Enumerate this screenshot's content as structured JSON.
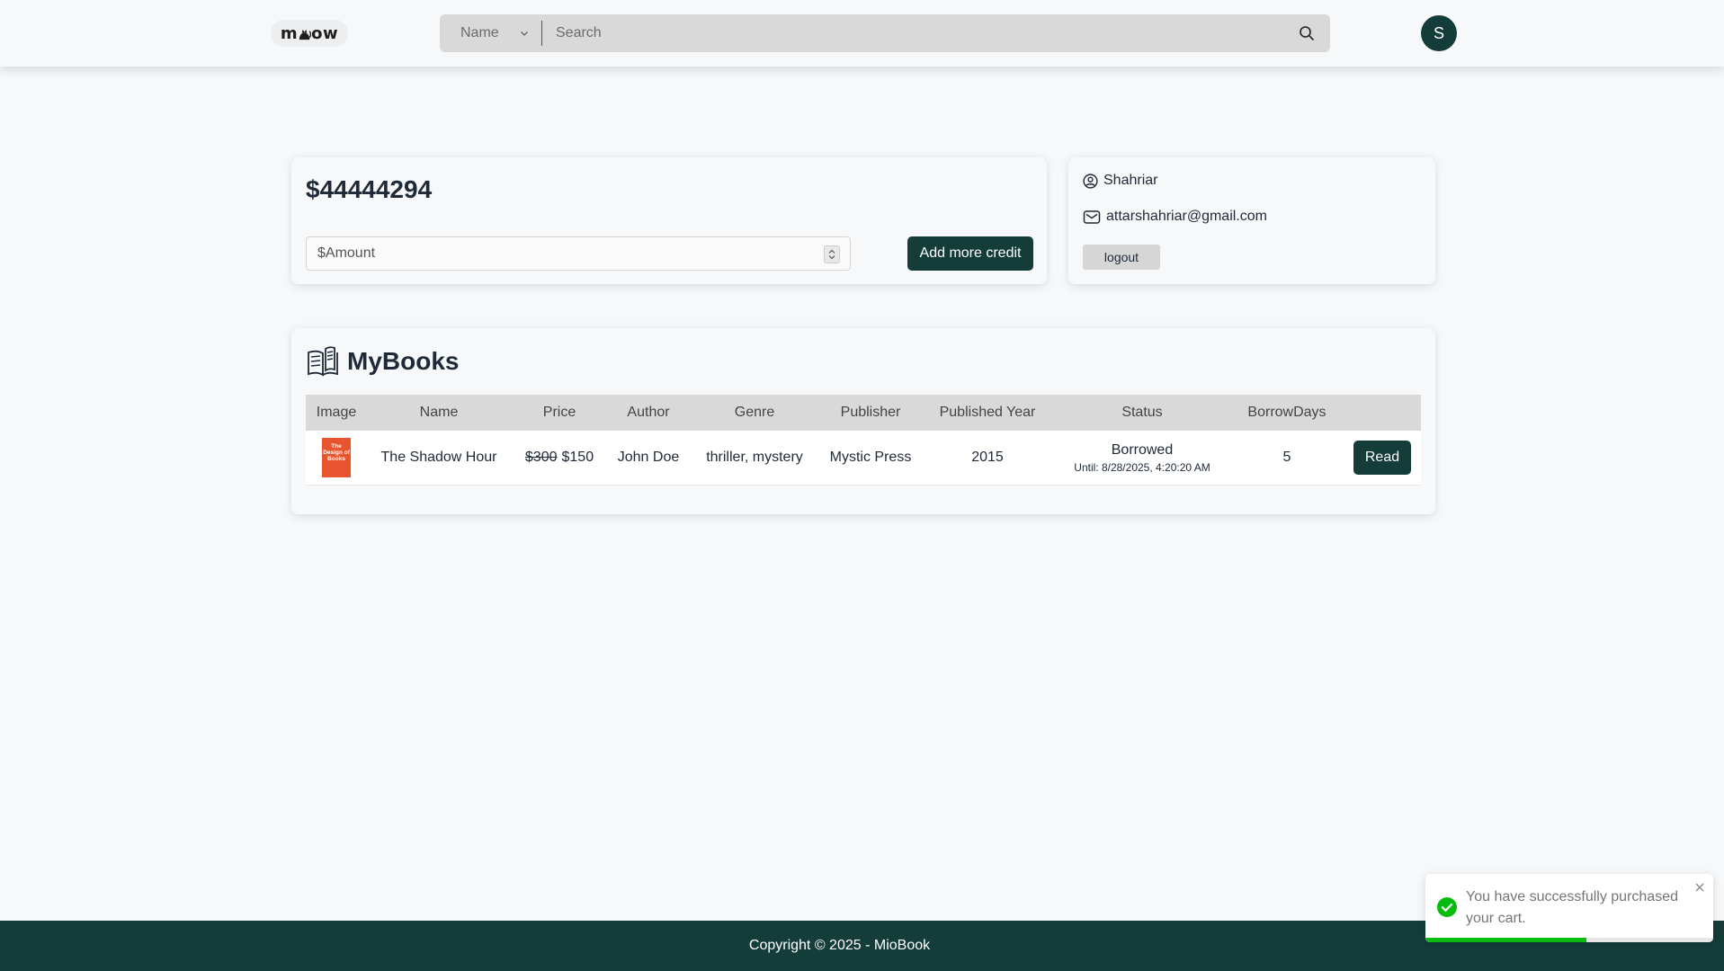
{
  "header": {
    "logo_text_left": "m",
    "logo_text_right": "ow",
    "search_select_value": "Name",
    "search_placeholder": "Search",
    "avatar_initial": "S"
  },
  "credit": {
    "balance": "$44444294",
    "amount_placeholder": "$Amount",
    "add_button_label": "Add more credit"
  },
  "profile": {
    "name": "Shahriar",
    "email": "attarshahriar@gmail.com",
    "logout_label": "logout"
  },
  "books": {
    "title": "MyBooks",
    "columns": [
      "Image",
      "Name",
      "Price",
      "Author",
      "Genre",
      "Publisher",
      "Published Year",
      "Status",
      "BorrowDays"
    ],
    "rows": [
      {
        "cover_text": "The Design of Books",
        "cover_color": "#e7542d",
        "name": "The Shadow Hour",
        "original_price": "$300",
        "price": "$150",
        "author": "John Doe",
        "genre": "thriller, mystery",
        "publisher": "Mystic Press",
        "published_year": "2015",
        "status": "Borrowed",
        "status_until": "Until: 8/28/2025, 4:20:20 AM",
        "borrow_days": "5",
        "action_label": "Read"
      }
    ]
  },
  "footer": {
    "copyright": "Copyright © 2025 - MioBook"
  },
  "toast": {
    "message": "You have successfully purchased your cart.",
    "progress_fraction": 0.56,
    "icon": "check-circle-icon"
  },
  "colors": {
    "brand": "#143d3a",
    "background": "#f6f8fa",
    "success": "#07bc0c",
    "book_cover": "#e7542d"
  }
}
